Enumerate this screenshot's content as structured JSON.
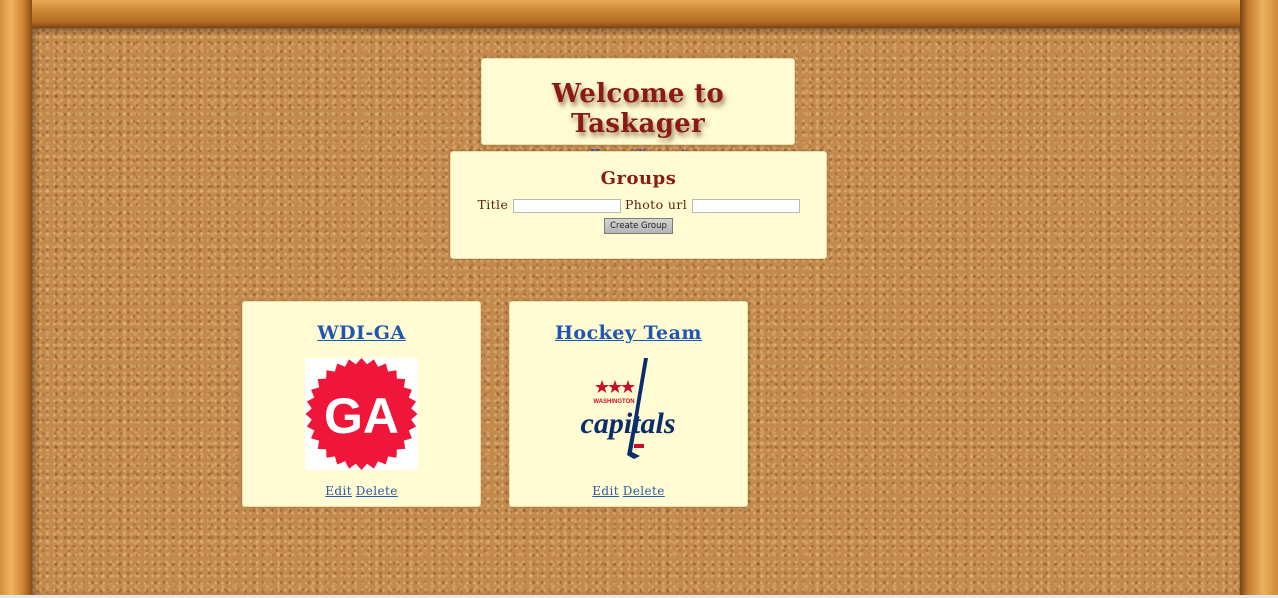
{
  "header": {
    "title": "Welcome to Taskager",
    "nav": [
      {
        "label": "Home"
      },
      {
        "label": "Signout"
      }
    ]
  },
  "groups_form": {
    "heading": "Groups",
    "title_label": "Title",
    "title_value": "",
    "photo_label": "Photo url",
    "photo_value": "",
    "submit_label": "Create Group"
  },
  "groups": [
    {
      "title": "WDI-GA",
      "logo": "ga-logo",
      "logo_text": "GA",
      "edit_label": "Edit",
      "delete_label": "Delete"
    },
    {
      "title": "Hockey Team",
      "logo": "capitals-logo",
      "logo_text_top": "WASHINGTON",
      "logo_text": "capitals",
      "edit_label": "Edit",
      "delete_label": "Delete"
    }
  ],
  "colors": {
    "card_background": "#fffbd2",
    "heading_red": "#8b1a12",
    "link_blue": "#1f55b4",
    "ga_red": "#f0163a",
    "capitals_navy": "#0c2d6b",
    "capitals_red": "#c8102e"
  }
}
